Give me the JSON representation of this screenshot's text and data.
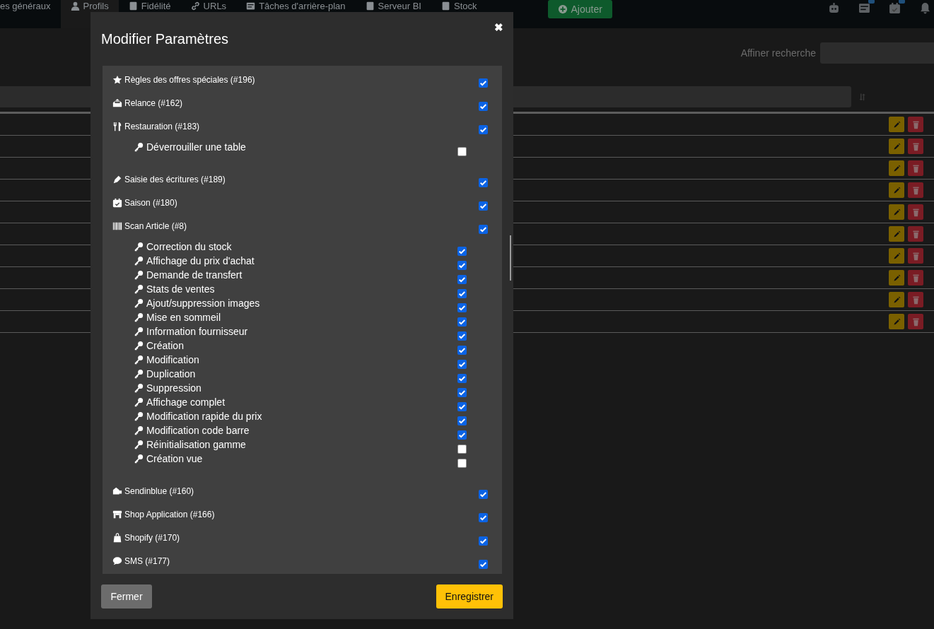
{
  "nav": {
    "tabs": [
      {
        "label": "es généraux",
        "selected": false
      },
      {
        "label": "Profils",
        "selected": true
      },
      {
        "label": "Fidélité",
        "selected": false
      },
      {
        "label": "URLs",
        "selected": false
      },
      {
        "label": "Tâches d'arrière-plan",
        "selected": false
      },
      {
        "label": "Serveur BI",
        "selected": false
      },
      {
        "label": "Stock",
        "selected": false
      }
    ],
    "add_button": "Ajouter"
  },
  "search": {
    "label": "Affiner recherche"
  },
  "modal": {
    "title": "Modifier Paramètres",
    "close": "✖",
    "modules": [
      {
        "label": "Règles des offres spéciales (#196)",
        "checked": true
      },
      {
        "label": "Relance (#162)",
        "checked": true
      },
      {
        "label": "Restauration (#183)",
        "checked": true,
        "children": [
          {
            "label": "Déverrouiller une table",
            "checked": false
          }
        ]
      },
      {
        "label": "Saisie des écritures (#189)",
        "checked": true
      },
      {
        "label": "Saison (#180)",
        "checked": true
      },
      {
        "label": "Scan Article (#8)",
        "checked": true,
        "children": [
          {
            "label": "Correction du stock",
            "checked": true
          },
          {
            "label": "Affichage du prix d'achat",
            "checked": true
          },
          {
            "label": "Demande de transfert",
            "checked": true
          },
          {
            "label": "Stats de ventes",
            "checked": true
          },
          {
            "label": "Ajout/suppression images",
            "checked": true
          },
          {
            "label": "Mise en sommeil",
            "checked": true
          },
          {
            "label": "Information fournisseur",
            "checked": true
          },
          {
            "label": "Création",
            "checked": true
          },
          {
            "label": "Modification",
            "checked": true
          },
          {
            "label": "Duplication",
            "checked": true
          },
          {
            "label": "Suppression",
            "checked": true
          },
          {
            "label": "Affichage complet",
            "checked": true
          },
          {
            "label": "Modification rapide du prix",
            "checked": true
          },
          {
            "label": "Modification code barre",
            "checked": true
          },
          {
            "label": "Réinitialisation gamme",
            "checked": false
          },
          {
            "label": "Création vue",
            "checked": false
          }
        ]
      },
      {
        "label": "Sendinblue (#160)",
        "checked": true
      },
      {
        "label": "Shop Application (#166)",
        "checked": true
      },
      {
        "label": "Shopify (#170)",
        "checked": true
      },
      {
        "label": "SMS (#177)",
        "checked": true
      }
    ],
    "buttons": [
      {
        "label": "Fermer",
        "kind": "secondary"
      },
      {
        "label": "Enregistrer",
        "kind": "primary"
      }
    ]
  }
}
